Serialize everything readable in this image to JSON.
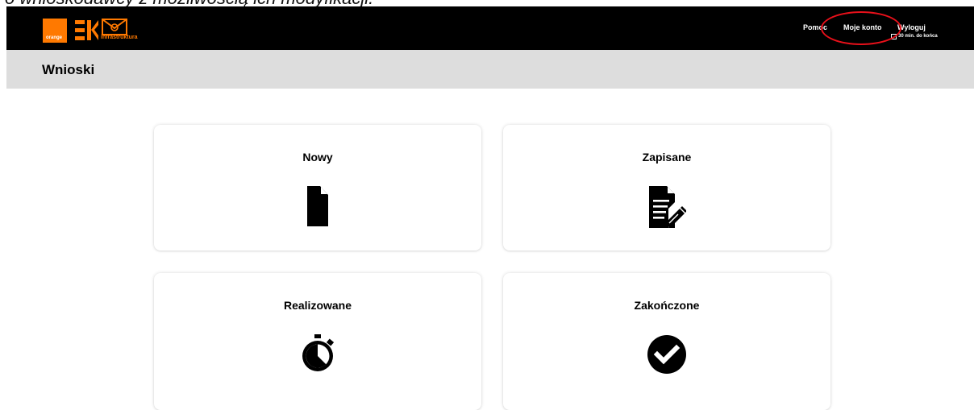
{
  "caption": "o wnioskodawcy z możliwością ich modyfikacji.",
  "header": {
    "brand_mark": "orange",
    "brand_sub": "infrastruktura",
    "nav": {
      "help": "Pomoc",
      "account": "Moje konto",
      "logout": "Wyloguj"
    },
    "session_timer": "30 min. do końca",
    "colors": {
      "background": "#000000",
      "brand": "#ff7900",
      "highlight": "#e8101a"
    }
  },
  "titlebar": {
    "title": "Wnioski"
  },
  "cards": [
    {
      "label": "Nowy",
      "icon": "document-icon"
    },
    {
      "label": "Zapisane",
      "icon": "document-edit-icon"
    },
    {
      "label": "Realizowane",
      "icon": "stopwatch-icon"
    },
    {
      "label": "Zakończone",
      "icon": "check-circle-icon"
    }
  ]
}
